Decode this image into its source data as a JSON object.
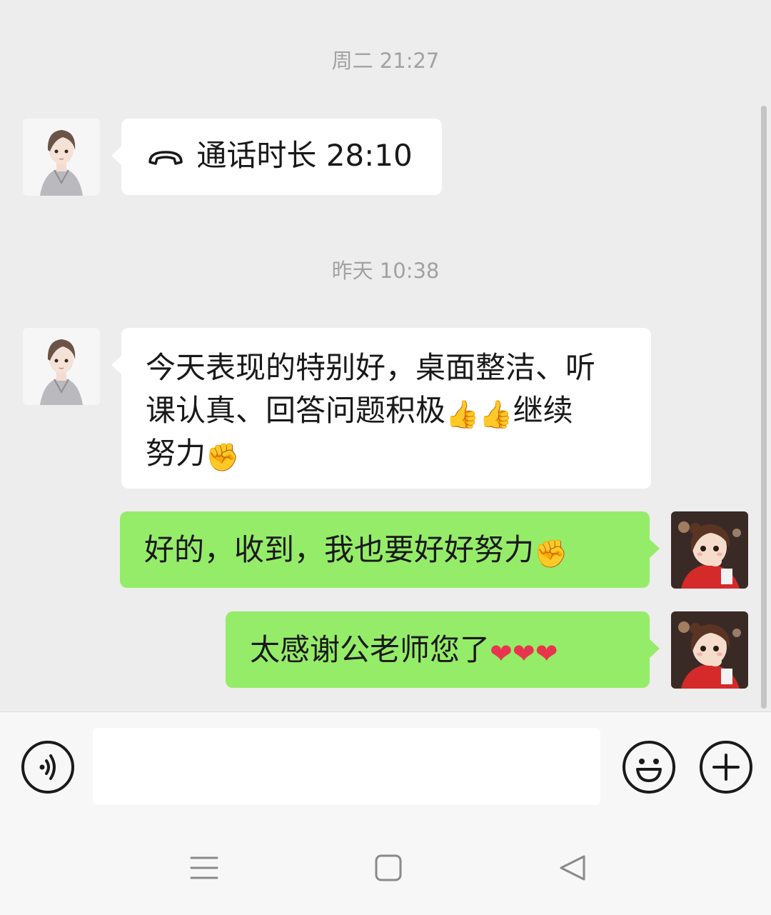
{
  "chat": {
    "timestamp_1": "周二 21:27",
    "call_message": "通话时长 28:10",
    "timestamp_2": "昨天 10:38",
    "msg_teacher_line1": "今天表现的特别好，桌面整洁、听",
    "msg_teacher_line2_a": "课认真、回答问题积极",
    "msg_teacher_line2_b": "继续",
    "msg_teacher_line3": "努力",
    "msg_reply_1": "好的，收到，我也要好好努力",
    "msg_reply_2": "太感谢公老师您了",
    "emoji_thumbs": "👍",
    "emoji_fist": "✊",
    "emoji_heart": "❤"
  },
  "composer": {
    "placeholder": ""
  },
  "icons": {
    "call": "phone-hangup-icon",
    "voice": "voice-icon",
    "emoji": "emoji-icon",
    "more": "plus-icon",
    "menu": "menu-icon",
    "home": "home-icon",
    "back": "back-icon"
  },
  "colors": {
    "background": "#ededed",
    "incoming_bubble": "#ffffff",
    "outgoing_bubble": "#95ec69",
    "timestamp_text": "#a2a2a2"
  }
}
